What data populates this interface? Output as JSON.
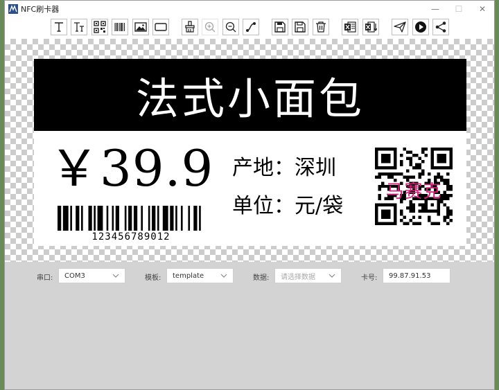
{
  "window": {
    "title": "NFC刷卡器",
    "minimize": "—",
    "maximize": "☐",
    "close": "✕"
  },
  "toolbar": {
    "buttons": [
      {
        "name": "text-tool-icon"
      },
      {
        "name": "rich-text-tool-icon"
      },
      {
        "name": "qrcode-tool-icon"
      },
      {
        "name": "barcode-tool-icon"
      },
      {
        "name": "image-tool-icon"
      },
      {
        "name": "rectangle-tool-icon"
      },
      {
        "name": "clear-brush-icon"
      },
      {
        "name": "zoom-in-icon"
      },
      {
        "name": "zoom-out-icon"
      },
      {
        "name": "path-tool-icon"
      },
      {
        "name": "save-icon"
      },
      {
        "name": "save-as-icon"
      },
      {
        "name": "delete-icon"
      },
      {
        "name": "excel-import-icon"
      },
      {
        "name": "excel-export-icon"
      },
      {
        "name": "send-icon"
      },
      {
        "name": "play-icon"
      },
      {
        "name": "share-icon"
      }
    ]
  },
  "label": {
    "header": "法式小面包",
    "price": "￥39.9",
    "origin": "产地：深圳",
    "unit": "单位：元/袋",
    "barcode_number": "123456789012",
    "qr_overlay_text": "马赛克"
  },
  "form": {
    "port_label": "串口:",
    "port_value": "COM3",
    "template_label": "模板:",
    "template_value": "template",
    "data_label": "数据:",
    "data_placeholder": "请选择数据",
    "card_label": "卡号:",
    "card_value": "99.87.91.53"
  },
  "colors": {
    "header_bg": "#000000",
    "overlay_text": "#d4207a",
    "window_bg": "#d3d3d3"
  }
}
